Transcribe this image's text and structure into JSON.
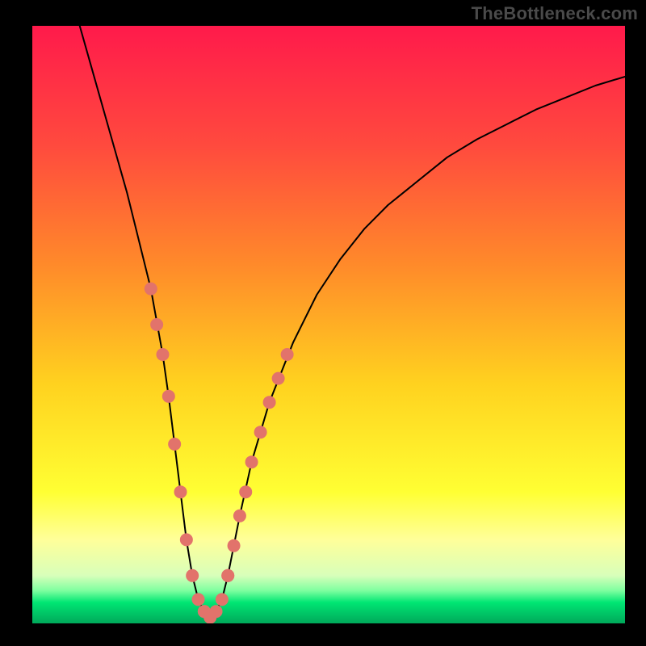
{
  "watermark": "TheBottleneck.com",
  "chart_data": {
    "type": "line",
    "title": "",
    "xlabel": "",
    "ylabel": "",
    "xlim": [
      0,
      100
    ],
    "ylim": [
      0,
      100
    ],
    "background_gradient": {
      "stops": [
        {
          "offset": 0.0,
          "color": "#ff1a4b"
        },
        {
          "offset": 0.2,
          "color": "#ff4a3e"
        },
        {
          "offset": 0.4,
          "color": "#ff8a2a"
        },
        {
          "offset": 0.6,
          "color": "#ffd21f"
        },
        {
          "offset": 0.78,
          "color": "#ffff33"
        },
        {
          "offset": 0.86,
          "color": "#ffff9a"
        },
        {
          "offset": 0.92,
          "color": "#d8ffba"
        },
        {
          "offset": 0.945,
          "color": "#7fffa0"
        },
        {
          "offset": 0.965,
          "color": "#00e673"
        },
        {
          "offset": 1.0,
          "color": "#00a85a"
        }
      ]
    },
    "series": [
      {
        "name": "bottleneck-curve",
        "x": [
          8,
          10,
          12,
          14,
          16,
          18,
          20,
          22,
          23,
          24,
          25,
          26,
          27,
          28,
          29,
          30,
          31,
          32,
          33,
          34,
          35,
          37,
          40,
          44,
          48,
          52,
          56,
          60,
          65,
          70,
          75,
          80,
          85,
          90,
          95,
          100
        ],
        "y": [
          100,
          93,
          86,
          79,
          72,
          64,
          56,
          45,
          38,
          30,
          22,
          14,
          8,
          4,
          2,
          1,
          2,
          4,
          8,
          13,
          18,
          27,
          37,
          47,
          55,
          61,
          66,
          70,
          74,
          78,
          81,
          83.5,
          86,
          88,
          90,
          91.5
        ],
        "stroke": "#000000",
        "stroke_width": 2
      }
    ],
    "markers": [
      {
        "name": "left-dots",
        "color": "#e2736b",
        "radius": 8,
        "points": [
          {
            "x": 20,
            "y": 56
          },
          {
            "x": 21,
            "y": 50
          },
          {
            "x": 22,
            "y": 45
          },
          {
            "x": 23,
            "y": 38
          },
          {
            "x": 24,
            "y": 30
          },
          {
            "x": 25,
            "y": 22
          },
          {
            "x": 26,
            "y": 14
          },
          {
            "x": 27,
            "y": 8
          },
          {
            "x": 28,
            "y": 4
          },
          {
            "x": 29,
            "y": 2
          }
        ]
      },
      {
        "name": "bottom-dots",
        "color": "#e2736b",
        "radius": 8,
        "points": [
          {
            "x": 29,
            "y": 2
          },
          {
            "x": 30,
            "y": 1
          },
          {
            "x": 31,
            "y": 2
          },
          {
            "x": 32,
            "y": 4
          },
          {
            "x": 33,
            "y": 8
          }
        ]
      },
      {
        "name": "right-dots",
        "color": "#e2736b",
        "radius": 8,
        "points": [
          {
            "x": 33,
            "y": 8
          },
          {
            "x": 34,
            "y": 13
          },
          {
            "x": 35,
            "y": 18
          },
          {
            "x": 36,
            "y": 22
          },
          {
            "x": 37,
            "y": 27
          },
          {
            "x": 38.5,
            "y": 32
          },
          {
            "x": 40,
            "y": 37
          },
          {
            "x": 41.5,
            "y": 41
          },
          {
            "x": 43,
            "y": 45
          }
        ]
      }
    ]
  }
}
